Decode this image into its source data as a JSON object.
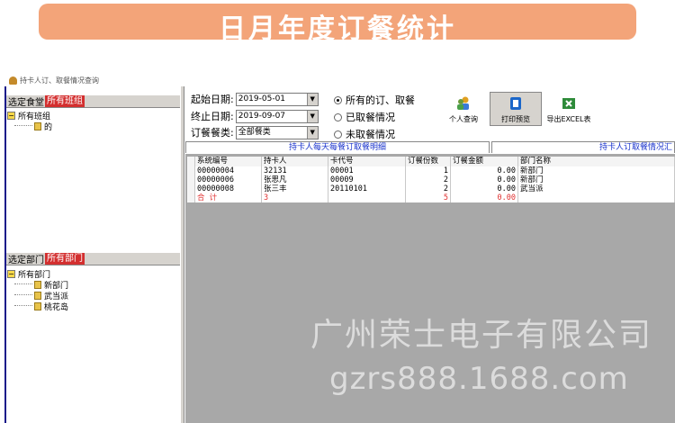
{
  "banner": {
    "title": "日月年度订餐统计"
  },
  "window": {
    "title": "持卡人订、取餐情况查询"
  },
  "left_panel": {
    "canteen": {
      "label": "选定食堂",
      "value": "所有班组"
    },
    "canteen_tree": {
      "root": "所有班组",
      "children": [
        "的"
      ]
    },
    "department": {
      "label": "选定部门",
      "value": "所有部门"
    },
    "department_tree": {
      "root": "所有部门",
      "children": [
        "新部门",
        "武当派",
        "桃花岛"
      ]
    }
  },
  "form": {
    "start_label": "起始日期:",
    "start_value": "2019-05-01",
    "end_label": "终止日期:",
    "end_value": "2019-09-07",
    "meal_label": "订餐餐类:",
    "meal_value": "全部餐类",
    "radios": [
      "所有的订、取餐",
      "已取餐情况",
      "未取餐情况"
    ],
    "radio_selected": 0
  },
  "toolbar": {
    "personal": "个人查询",
    "print": "打印预览",
    "export": "导出EXCEL表"
  },
  "tabs": [
    "持卡人每天每餐订取餐明细",
    "持卡人订取餐情况汇"
  ],
  "table": {
    "headers": [
      "系统编号",
      "持卡人",
      "卡代号",
      "订餐份数",
      "订餐金额",
      "部门名称"
    ],
    "rows": [
      [
        "00000004",
        "32131",
        "00001",
        "1",
        "0.00",
        "新部门"
      ],
      [
        "00000006",
        "张思凡",
        "00009",
        "2",
        "0.00",
        "新部门"
      ],
      [
        "00000008",
        "张三丰",
        "20110101",
        "2",
        "0.00",
        "武当派"
      ]
    ],
    "total": [
      "合  计",
      "3",
      "",
      "5",
      "0.00",
      ""
    ]
  },
  "watermark": {
    "company": "广州荣士电子有限公司",
    "url": "gzrs888.1688.com"
  },
  "colors": {
    "banner": "#f3a479",
    "highlight": "#d32f2f",
    "tab_text": "#1a33cc",
    "total_text": "#e03030"
  }
}
